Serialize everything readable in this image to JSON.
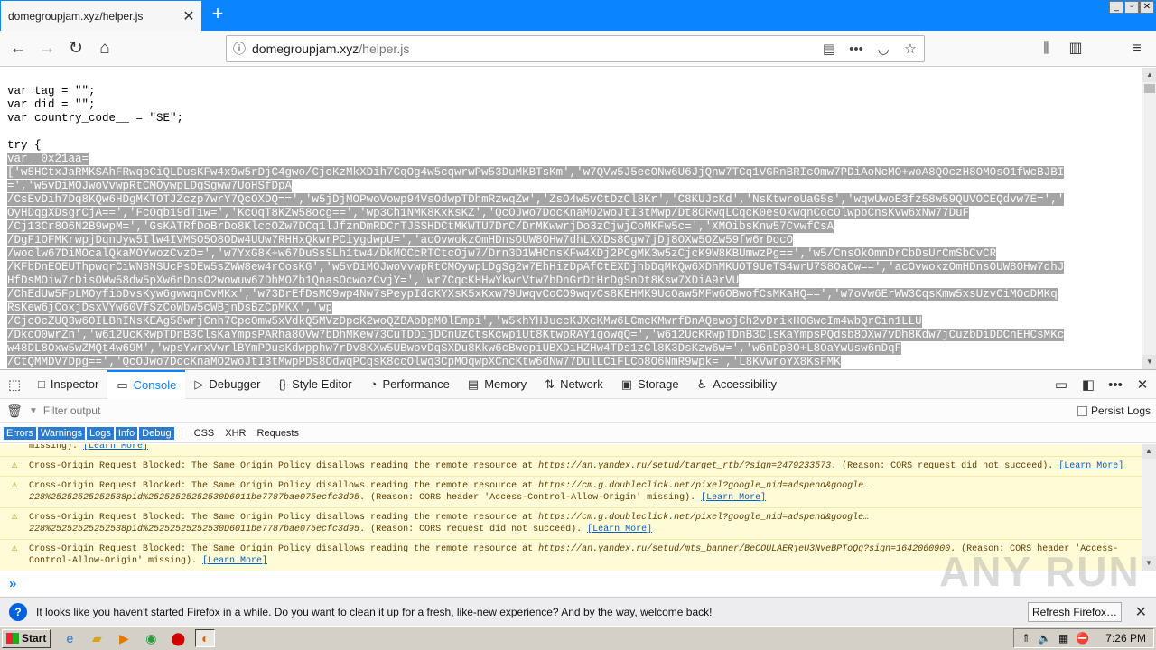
{
  "tab": {
    "title": "domegroupjam.xyz/helper.js",
    "close": "✕",
    "new": "+"
  },
  "window": {
    "min": "_",
    "max": "▫",
    "close": "✕"
  },
  "nav": {
    "back": "←",
    "forward": "→",
    "reload": "↻",
    "home": "⌂"
  },
  "url": {
    "host": "domegroupjam.xyz",
    "path": "/helper.js"
  },
  "source": {
    "lines_plain": [
      "",
      "var tag = \"\";",
      "var did = \"\";",
      "var country_code__ = \"SE\";",
      "",
      "try {"
    ],
    "lines_selected": [
      "var _0x21aa=",
      "['w5HCtxJaRMKSAhFRwqbCiQLDusKFw4x9w5rDjC4gwo/CjcKzMkXDih7CqOg4w5cqwrwPw53DuMKBTsKm','w7QVw5J5ecONw6U6JjQnw7TCq1VGRnBRIcOmw7PDiAoNcMO+woA8QOczH8OMOsO1fWcBJBI",
      "=','w5vDiMOJwoVvwpRtCMOywpLDgSgww7UoHSfDpA",
      "/CsEvDih7Dq8KQw6HDgMKTOTJZczp7wrY7QcOXDQ==','w5jDjMOPwoVowp94VsOdwpTDhmRzwqZw','ZsO4w5vCtDzCl8Kr','C8KUJcKd','NsKtwroUaG5s','wqwUwoE3fz58w59QUVOCEQdvw7E=','",
      "OyHDqgXDsgrCjA==','FcOqb19dT1w=','KcOqT8KZw58ocg==','wp3Ch1NMK8KxKsKZ','QcOJwo7DocKnaMO2woJtI3tMwp/Dt8ORwqLCqcK0esOkwqnCocOlwpbCnsKvw6xNw77DuF",
      "/Cj13Cr8O6N2B9wpM=','GsKATRfDoBrDo8KlccOZw7DCq1lJfznDmRDCrTJSSHDCtMKWTU7DrC/DrMKwwrjDo3zCjwjCoMKFw5c=','XMOibsKnw57CvwfCsA",
      "/DgF1OFMKrwpjDqnUyw5Ilw4IVMSO5O8ODw4UUw7RHHxQkwrPCiygdwpU=','acOvwokzOmHDnsOUW8OHw7dhLXXDs8Ogw7jDj8OXw5OZw59fw6rDocO",
      "/woolw67DiMOcalQkaMOYwozCvzO=','w7YxG8K+w67DuSsSLh1tw4/DkMOCcRTCtcOjw7/Drn3D1WHCnsKFw4XDj2PCgMK3w5zCjcK9W8KBUmwzPg==','w5/CnsOkOmnDrCbDsUrCmSbCvCR",
      "/KFbDnEOEUThpwqrCiWN8NSUcPsOEw5sZWW8ew4rCosKG','w5vDiMOJwoVvwpRtCMOywpLDgSg2w7EhHizDpAfCtEXDjhbDqMKQw6XDhMKUOT9UeTS4wrU7S8OaCw==','acOvwokzOmHDnsOUW8OHw7dhJ",
      "HfDsMOiw7rDisOWw58dw5pXw6nDosO2wowuw67DhMOZb1QnasOcwozCvjY=','wr7CqcKHHwYkwrVtw7bDnGrDtHrDgSnDt8Ksw7XDiA9rVU",
      "/ChEdUw5FpLMOyfibDvsKyw6gwwqnCvMKx','w73DrEfDsMO9wp4Nw7sPeypIdcKYXsK5xKxw79UwqvCoCO9wqvCs8KEHMK9UcOaw5MFw6OBwofCsMKaHQ==','w7oVw6ErWW3CqsKmw5xsUzvCiMOcDMKq",
      "RsKew6jCoxjDsxVYw60VfSzCoWbw5cWBjnDsBzCpMKX','wp",
      "/CjcOcZUQ3w6OILBhINsKEAg58wrjCnh7CpcOmw5xVdkQ5MVzDpcK2woQZBAbDpMOlEmpi','w5khYHJuccKJXcKMw6LCmcKMwrfDnAQewojCh2vDrikHOGwcIm4wbQrCin1LLU",
      "/DkcO0wrZn','w612UcKRwpTDnB3ClsKaYmpsPARha8OVw7bDhMKew73CuTDDijDCnUzCtsKcwp1Ut8KtwpRAY1gowqQ=','w612UcKRwpTDnB3ClsKaYmpsPQdsb8OXw7vDh8Kdw7jCuzbDiDDCnEHCsMKc",
      "w48DL8Oxw5wZMQt4w69M','wpsYwrxVwrlBYmPDusKdwpphw7rDv8KXw5UBwovDqSXDu8Kkw6cBwopiUBXDiHZHw4TDs1zCl8K3DsKzw6w=','w6nDp8O+L8OaYwUsw6nDqF",
      "/CtQMMDV7Dpg==','QcOJwo7DocKnaMO2woJtI3tMwpPDs8OdwqPCqsK8ccOlwq3CpMOqwpXCncKtw6dNw77DulLCiFLCo8O6NmR9wpk=','L8KVwroYX8KsFMK"
    ]
  },
  "devtools": {
    "tabs": [
      {
        "label": "Inspector",
        "icon": "□"
      },
      {
        "label": "Console",
        "icon": "▭"
      },
      {
        "label": "Debugger",
        "icon": "▷"
      },
      {
        "label": "Style Editor",
        "icon": "{}"
      },
      {
        "label": "Performance",
        "icon": "◔"
      },
      {
        "label": "Memory",
        "icon": "▤"
      },
      {
        "label": "Network",
        "icon": "⇅"
      },
      {
        "label": "Storage",
        "icon": "▣"
      },
      {
        "label": "Accessibility",
        "icon": "♿"
      }
    ],
    "filter_placeholder": "Filter output",
    "persist_label": "Persist Logs",
    "levels": [
      "Errors",
      "Warnings",
      "Logs",
      "Info",
      "Debug"
    ],
    "categories": [
      "CSS",
      "XHR",
      "Requests"
    ],
    "messages": [
      {
        "pre": "missing). ",
        "url": "",
        "post": "",
        "learn": "[Learn More]",
        "partial": true
      },
      {
        "pre": "Cross-Origin Request Blocked: The Same Origin Policy disallows reading the remote resource at ",
        "url": "https://an.yandex.ru/setud/target_rtb/?sign=2479233573",
        "post": ". (Reason: CORS request did not succeed). ",
        "learn": "[Learn More]"
      },
      {
        "pre": "Cross-Origin Request Blocked: The Same Origin Policy disallows reading the remote resource at ",
        "url": "https://cm.g.doubleclick.net/pixel?google_nid=adspend&google…228%25252525252538pid%25252525252530D6011be7787bae075ecfc3d95",
        "post": ". (Reason: CORS header 'Access-Control-Allow-Origin' missing). ",
        "learn": "[Learn More]"
      },
      {
        "pre": "Cross-Origin Request Blocked: The Same Origin Policy disallows reading the remote resource at ",
        "url": "https://cm.g.doubleclick.net/pixel?google_nid=adspend&google…228%25252525252538pid%25252525252530D6011be7787bae075ecfc3d95",
        "post": ". (Reason: CORS request did not succeed). ",
        "learn": "[Learn More]"
      },
      {
        "pre": "Cross-Origin Request Blocked: The Same Origin Policy disallows reading the remote resource at ",
        "url": "https://an.yandex.ru/setud/mts_banner/BeCOULAERjeU3NveBPToQg?sign=1642060900",
        "post": ". (Reason: CORS header 'Access-Control-Allow-Origin' missing). ",
        "learn": "[Learn More]"
      }
    ],
    "prompt": "»"
  },
  "notification": {
    "text": "It looks like you haven't started Firefox in a while. Do you want to clean it up for a fresh, like-new experience? And by the way, welcome back!",
    "button": "Refresh Firefox…",
    "close": "✕"
  },
  "watermark": "ANY RUN",
  "taskbar": {
    "start": "Start",
    "time": "7:26 PM",
    "icons": [
      "ie-icon",
      "folder-icon",
      "media-icon",
      "chrome-icon",
      "opera-icon",
      "firefox-icon"
    ]
  }
}
